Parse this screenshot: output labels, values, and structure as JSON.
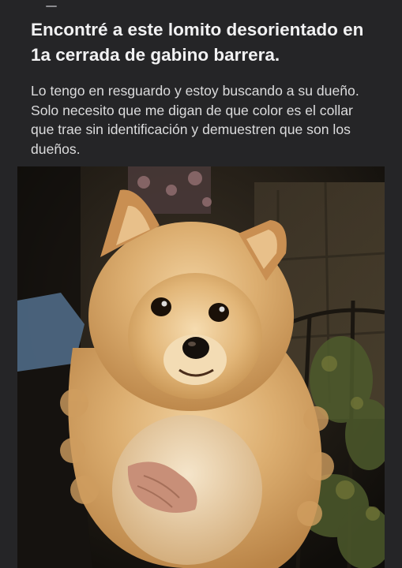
{
  "post": {
    "title": "Encontré a este lomito desorientado en 1a cerrada de gabino barrera.",
    "body": "Lo tengo en resguardo y estoy buscando a su dueño. Solo necesito que me digan de que color es el collar que trae sin identificación y demuestren que son los dueños."
  },
  "photo": {
    "subject": "pomeranian-dog-photo"
  },
  "colors": {
    "background": "#252527",
    "title_text": "#f2f2f3",
    "body_text": "#dcdcdd",
    "fur": "#d7a868"
  }
}
